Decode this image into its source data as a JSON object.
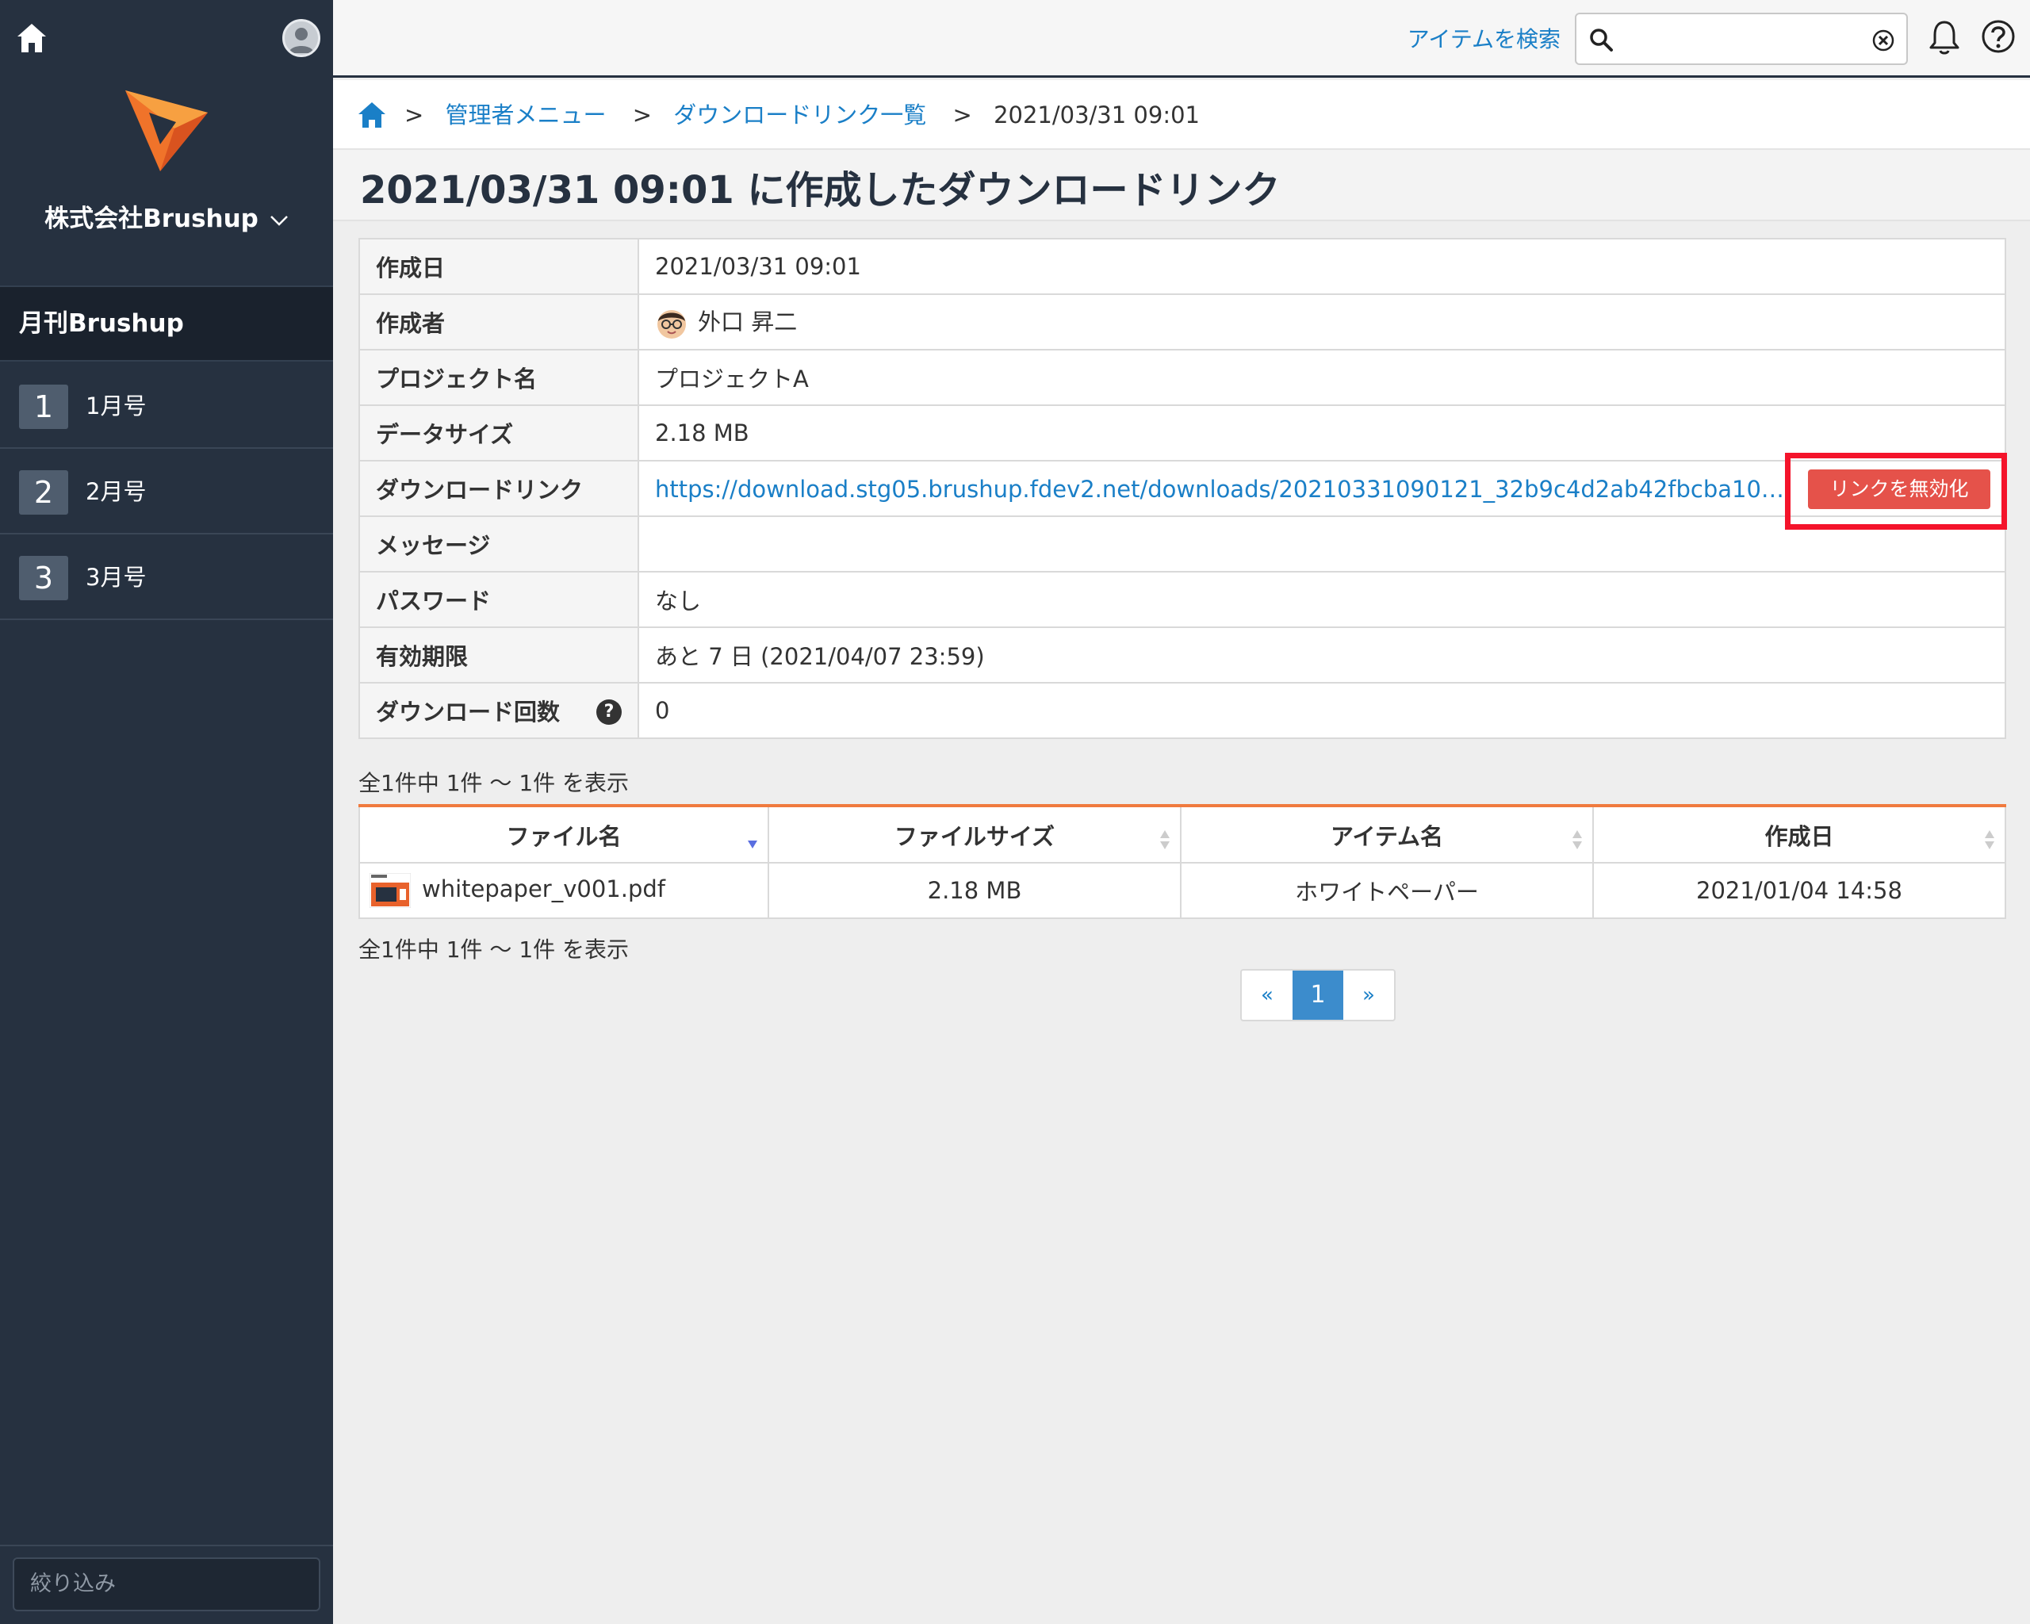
{
  "sidebar": {
    "company": "株式会社Brushup",
    "project": "月刊Brushup",
    "items": [
      {
        "num": "1",
        "label": "1月号"
      },
      {
        "num": "2",
        "label": "2月号"
      },
      {
        "num": "3",
        "label": "3月号"
      }
    ],
    "filter_placeholder": "絞り込み"
  },
  "topbar": {
    "search_link": "アイテムを検索",
    "search_value": ""
  },
  "breadcrumb": {
    "sep": ">",
    "items": [
      "管理者メニュー",
      "ダウンロードリンク一覧"
    ],
    "current": "2021/03/31 09:01"
  },
  "title": "2021/03/31 09:01 に作成したダウンロードリンク",
  "info": {
    "created_label": "作成日",
    "created_value": "2021/03/31 09:01",
    "creator_label": "作成者",
    "creator_value": "外口 昇二",
    "project_label": "プロジェクト名",
    "project_value": "プロジェクトA",
    "size_label": "データサイズ",
    "size_value": "2.18 MB",
    "link_label": "ダウンロードリンク",
    "link_value": "https://download.stg05.brushup.fdev2.net/downloads/20210331090121_32b9c4d2ab42fbcba1047…",
    "disable_button": "リンクを無効化",
    "message_label": "メッセージ",
    "message_value": "",
    "password_label": "パスワード",
    "password_value": "なし",
    "expiry_label": "有効期限",
    "expiry_value": "あと 7 日 (2021/04/07 23:59)",
    "count_label": "ダウンロード回数",
    "count_value": "0"
  },
  "files": {
    "count_text": "全1件中 1件 〜 1件 を表示",
    "headers": [
      "ファイル名",
      "ファイルサイズ",
      "アイテム名",
      "作成日"
    ],
    "rows": [
      {
        "name": "whitepaper_v001.pdf",
        "size": "2.18 MB",
        "item": "ホワイトペーパー",
        "date": "2021/01/04 14:58"
      }
    ]
  },
  "pager": {
    "prev": "«",
    "current": "1",
    "next": "»"
  },
  "colors": {
    "sidebar": "#263140",
    "accent": "#1a7fc7",
    "danger": "#e5524a",
    "highlight": "#f4142b",
    "table_top": "#f07a3e"
  },
  "icons": [
    "home-icon",
    "user-avatar-icon",
    "brushup-logo",
    "chevron-down-icon",
    "search-icon",
    "clear-icon",
    "bell-icon",
    "help-icon",
    "question-icon",
    "sort-icon"
  ]
}
